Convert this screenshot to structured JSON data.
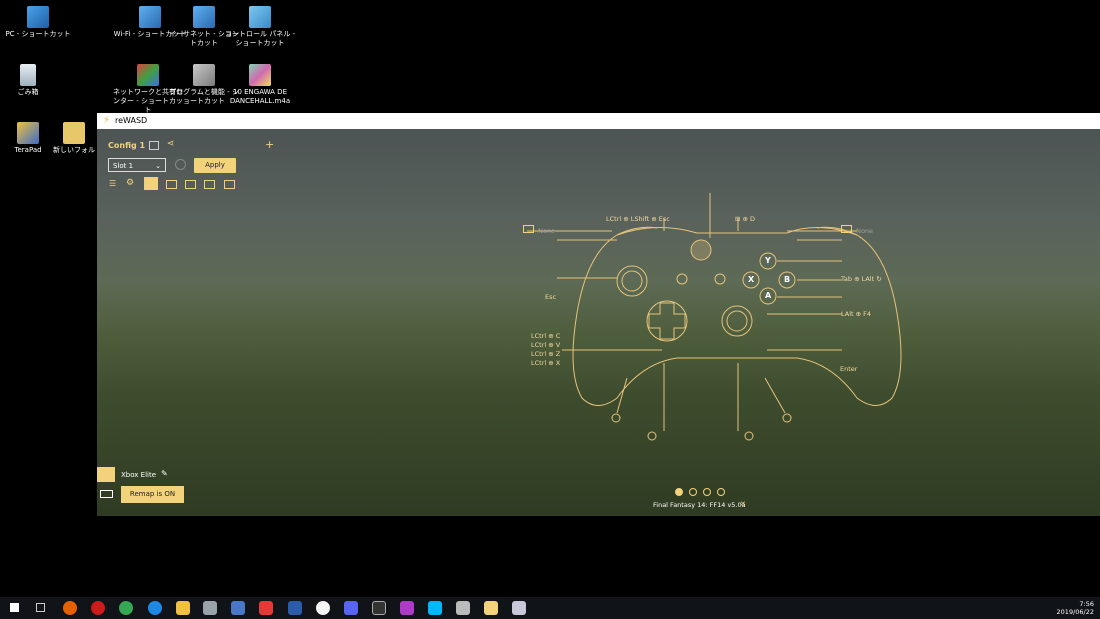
{
  "desktop": {
    "icons": [
      {
        "label": "PC - ショートカット"
      },
      {
        "label": "ごみ箱"
      },
      {
        "label": "TeraPad"
      },
      {
        "label": "新しいフォル"
      },
      {
        "label": "Wi-Fi - ショートカット"
      },
      {
        "label": "ネットワークと共有センター - ショートカット"
      },
      {
        "label": "イーサネット - ショートカット"
      },
      {
        "label": "プログラムと機能 - ショートカット"
      },
      {
        "label": "コントロール パネル - ショートカット"
      },
      {
        "label": "10 ENGAWA DE DANCEHALL.m4a"
      }
    ]
  },
  "window": {
    "title": "reWASD",
    "config_name": "Config 1",
    "add_symbol": "+",
    "slot_value": "Slot 1",
    "apply_label": "Apply",
    "device_name": "Xbox Elite",
    "remap_label": "Remap is ON",
    "game_profile": "Final Fantasy 14: FF14 v5.0a",
    "close_x": "✕"
  },
  "mappings": {
    "left_top": "None",
    "top_center": "LCtrl ⊕ LShift ⊕ Esc",
    "view_menu_combo": "⊞ ⊕ D",
    "right_top": "None",
    "esc": "Esc",
    "tab_lalt": "Tab ⊕ LAlt ↻",
    "lalt_f4": "LAlt ⊕ F4",
    "left_list": [
      "LCtrl ⊕ C",
      "LCtrl ⊕ V",
      "LCtrl ⊕ Z",
      "LCtrl ⊕ X"
    ],
    "enter": "Enter"
  },
  "buttons": {
    "y": "Y",
    "b": "B",
    "x": "X",
    "a": "A"
  },
  "taskbar": {
    "time": "7:56",
    "date": "2019/06/22"
  },
  "colors": {
    "accent": "#f3d27c",
    "line": "#e6c27a"
  }
}
